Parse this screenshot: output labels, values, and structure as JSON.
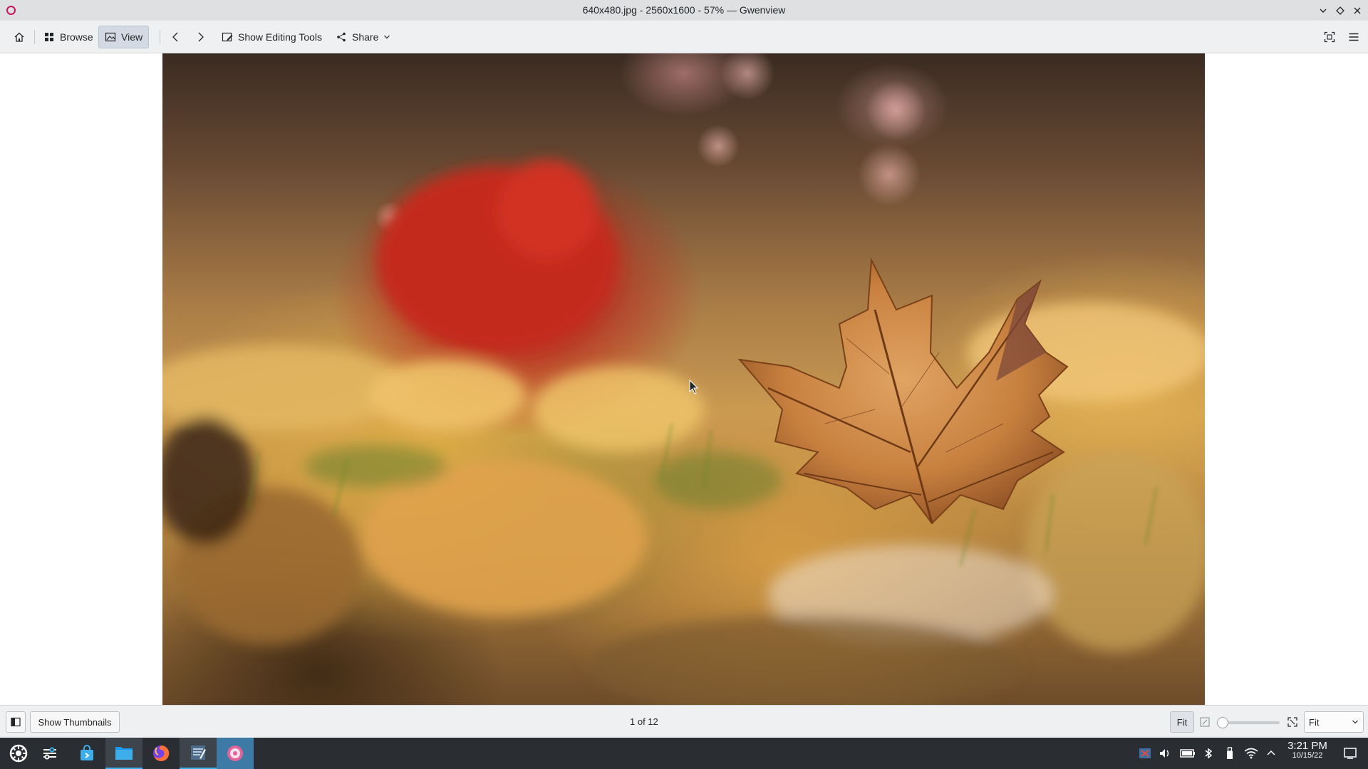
{
  "window": {
    "title": "640x480.jpg - 2560x1600 - 57% — Gwenview"
  },
  "toolbar": {
    "home_icon": "home-icon",
    "browse_label": "Browse",
    "view_label": "View",
    "show_editing_tools_label": "Show Editing Tools",
    "share_label": "Share"
  },
  "image": {
    "description_icon": "photo",
    "file": "640x480.jpg"
  },
  "statusbar": {
    "show_thumbnails_label": "Show Thumbnails",
    "position_text": "1 of 12",
    "fit_button_label": "Fit",
    "zoom_level_value": 0,
    "zoom_select_value": "Fit"
  },
  "taskbar": {
    "apps": [
      {
        "name": "application-launcher",
        "icon": "kde-launcher-icon"
      },
      {
        "name": "system-settings",
        "icon": "settings-sliders-icon"
      },
      {
        "name": "discover",
        "icon": "store-bag-icon"
      },
      {
        "name": "dolphin",
        "icon": "folder-icon"
      },
      {
        "name": "firefox",
        "icon": "firefox-icon"
      },
      {
        "name": "kwrite",
        "icon": "text-editor-icon"
      },
      {
        "name": "gwenview",
        "icon": "gwenview-icon"
      }
    ],
    "clock": {
      "time": "3:21 PM",
      "date": "10/15/22"
    }
  },
  "colors": {
    "accent": "#3daee9",
    "titlebar_bg": "#dee0e2",
    "toolbar_bg": "#eff0f1",
    "taskbar_bg": "#2a2e32"
  }
}
